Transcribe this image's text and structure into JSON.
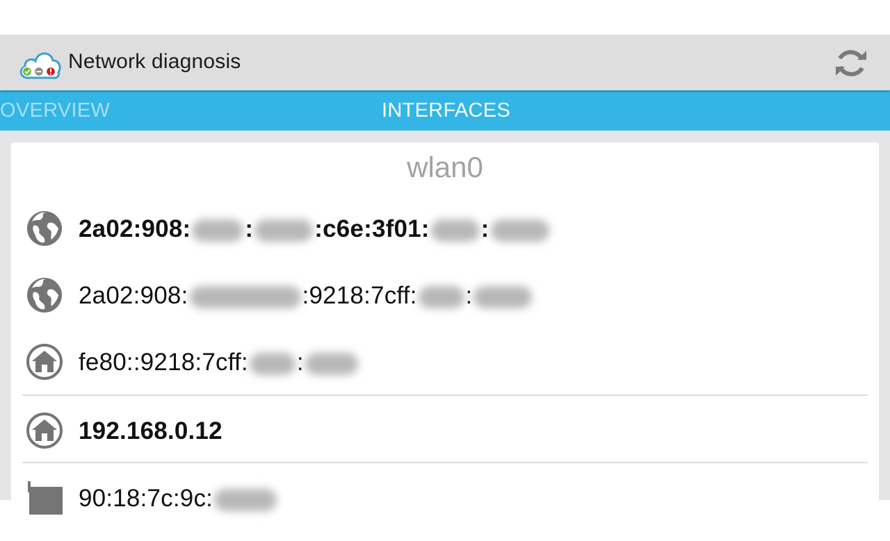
{
  "app": {
    "title": "Network diagnosis",
    "icon": "cloud-status-icon",
    "refresh_icon": "refresh-icon"
  },
  "tabs": [
    {
      "label": "OVERVIEW",
      "active": false
    },
    {
      "label": "INTERFACES",
      "active": true
    }
  ],
  "interface": {
    "name": "wlan0",
    "addresses": [
      {
        "icon": "globe-icon",
        "bold": true,
        "segments": [
          "2a02:908:",
          ":",
          ":c6e:3f01:",
          ":"
        ]
      },
      {
        "icon": "globe-icon",
        "bold": false,
        "segments": [
          "2a02:908:",
          ":9218:7cff:",
          ":"
        ]
      },
      {
        "icon": "home-icon",
        "bold": false,
        "segments": [
          "fe80::9218:7cff:",
          ":"
        ]
      },
      {
        "icon": "home-icon",
        "bold": true,
        "segments": [
          "192.168.0.12"
        ]
      },
      {
        "icon": "network-card-icon",
        "bold": false,
        "segments": [
          "90:18:7c:9c:"
        ]
      }
    ]
  },
  "colors": {
    "accent": "#33b5e5",
    "action_bar": "#dedede",
    "icon_gray": "#757575",
    "inactive_tab_text": "#a9e0f4"
  }
}
